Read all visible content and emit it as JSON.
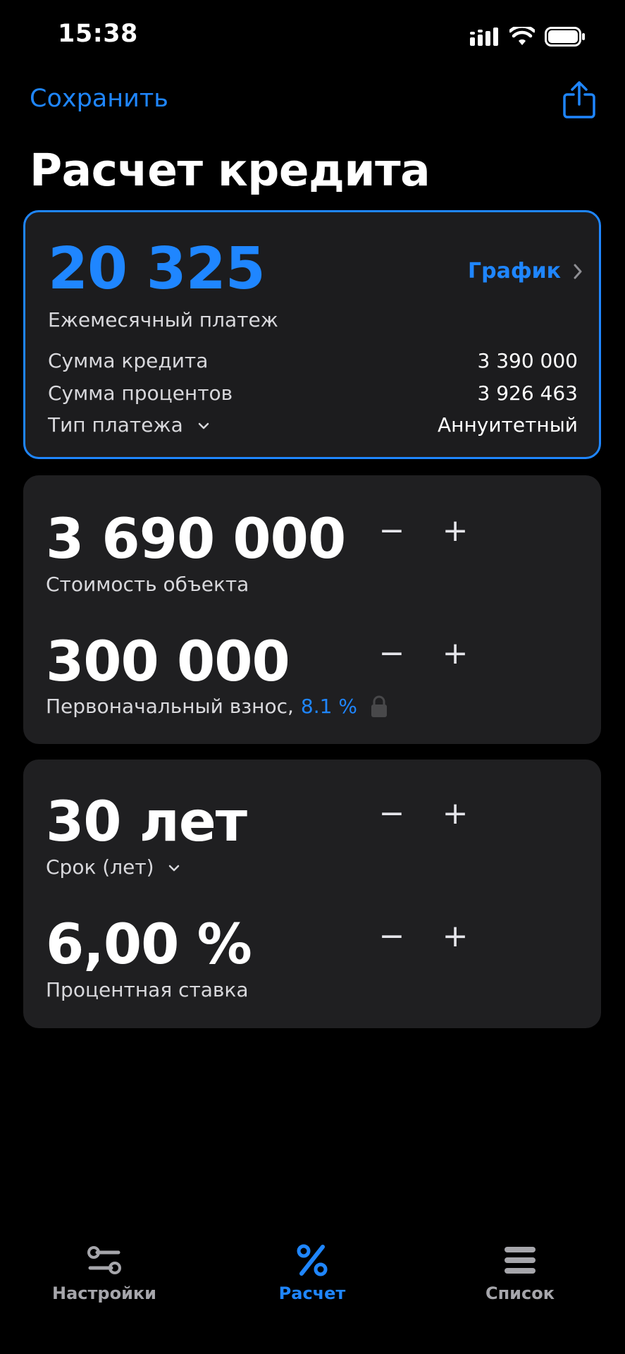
{
  "status_bar": {
    "time": "15:38"
  },
  "nav": {
    "save_label": "Сохранить",
    "title": "Расчет кредита"
  },
  "summary": {
    "monthly_payment": "20 325",
    "monthly_payment_label": "Ежемесячный платеж",
    "schedule_label": "График",
    "rows": [
      {
        "label": "Сумма кредита",
        "value": "3 390 000"
      },
      {
        "label": "Сумма процентов",
        "value": "3 926 463"
      },
      {
        "label": "Тип платежа",
        "value": "Аннуитетный"
      }
    ]
  },
  "property": {
    "cost_value": "3 690 000",
    "cost_label": "Стоимость объекта",
    "down_payment_value": "300 000",
    "down_payment_label": "Первоначальный взнос,",
    "down_payment_percent": "8.1 %"
  },
  "terms": {
    "term_value": "30 лет",
    "term_label": "Срок (лет)",
    "rate_value": "6,00 %",
    "rate_label": "Процентная ставка"
  },
  "stepper": {
    "minus": "−",
    "plus": "+"
  },
  "tabs": [
    {
      "label": "Настройки",
      "icon": "sliders-icon",
      "active": false
    },
    {
      "label": "Расчет",
      "icon": "percent-icon",
      "active": true
    },
    {
      "label": "Список",
      "icon": "list-icon",
      "active": false
    }
  ],
  "colors": {
    "accent": "#1f86ff",
    "background": "#000000",
    "card": "#1f1f21",
    "inactive_tab": "#a6a6ab"
  }
}
